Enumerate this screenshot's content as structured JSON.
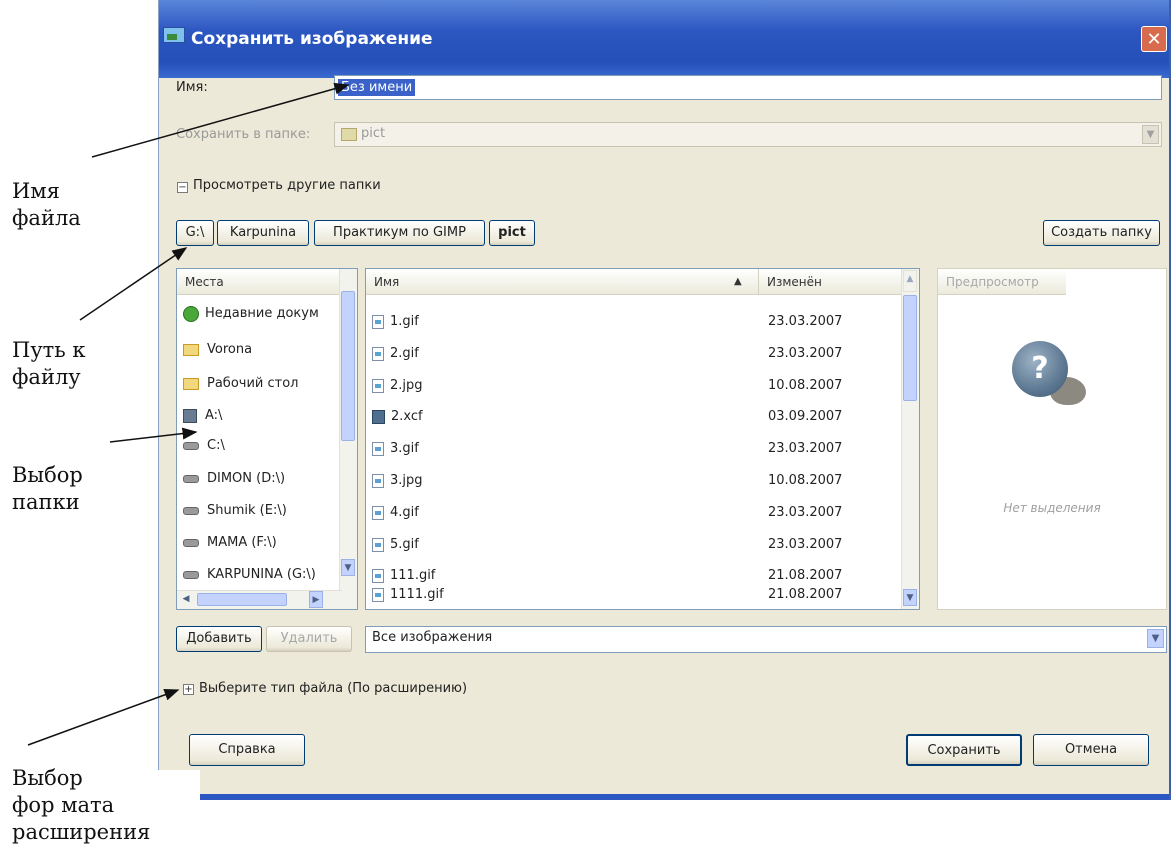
{
  "window": {
    "title": "Сохранить изображение",
    "close": "✕"
  },
  "form": {
    "name_label": "Имя:",
    "name_value": "Без имени",
    "save_in_label": "Сохранить в папке:",
    "save_in_value": "pict",
    "browse_label": "Просмотреть другие папки"
  },
  "path_buttons": [
    "G:\\",
    "Karpunina",
    "Практикум по GIMP",
    "pict"
  ],
  "create_folder": "Создать папку",
  "places": {
    "header": "Места",
    "items": [
      {
        "label": "Недавние докум",
        "icon": "recent-icon"
      },
      {
        "label": "Vorona",
        "icon": "folder-icon"
      },
      {
        "label": "Рабочий стол",
        "icon": "folder-icon"
      },
      {
        "label": "A:\\",
        "icon": "floppy-icon"
      },
      {
        "label": "C:\\",
        "icon": "drive-icon"
      },
      {
        "label": "DIMON (D:\\)",
        "icon": "drive-icon"
      },
      {
        "label": "Shumik (E:\\)",
        "icon": "drive-icon"
      },
      {
        "label": "MAMA (F:\\)",
        "icon": "drive-icon"
      },
      {
        "label": "KARPUNINA (G:\\)",
        "icon": "drive-icon"
      }
    ]
  },
  "files": {
    "col_name": "Имя",
    "col_modified": "Изменён",
    "sort_glyph": "▲",
    "rows": [
      {
        "name": "1.gif",
        "date": "23.03.2007",
        "icon": "file-icon"
      },
      {
        "name": "2.gif",
        "date": "23.03.2007",
        "icon": "file-icon"
      },
      {
        "name": "2.jpg",
        "date": "10.08.2007",
        "icon": "file-icon"
      },
      {
        "name": "2.xcf",
        "date": "03.09.2007",
        "icon": "xcf-icon"
      },
      {
        "name": "3.gif",
        "date": "23.03.2007",
        "icon": "file-icon"
      },
      {
        "name": "3.jpg",
        "date": "10.08.2007",
        "icon": "file-icon"
      },
      {
        "name": "4.gif",
        "date": "23.03.2007",
        "icon": "file-icon"
      },
      {
        "name": "5.gif",
        "date": "23.03.2007",
        "icon": "file-icon"
      },
      {
        "name": "111.gif",
        "date": "21.08.2007",
        "icon": "file-icon"
      },
      {
        "name": "1111.gif",
        "date": "21.08.2007",
        "icon": "file-icon"
      }
    ]
  },
  "preview": {
    "header": "Предпросмотр",
    "no_selection": "Нет выделения",
    "glyph": "?"
  },
  "buttons": {
    "add": "Добавить",
    "remove": "Удалить",
    "help": "Справка",
    "save": "Сохранить",
    "cancel": "Отмена"
  },
  "filter": {
    "value": "Все изображения"
  },
  "file_type": {
    "label": "Выберите тип файла (По расширению)"
  },
  "annotations": {
    "filename": [
      "Имя",
      "файла"
    ],
    "path": [
      "Путь к",
      "файлу"
    ],
    "folder": [
      "Выбор",
      "папки"
    ],
    "format": [
      "Выбор",
      "фор мата",
      "расширения"
    ]
  }
}
